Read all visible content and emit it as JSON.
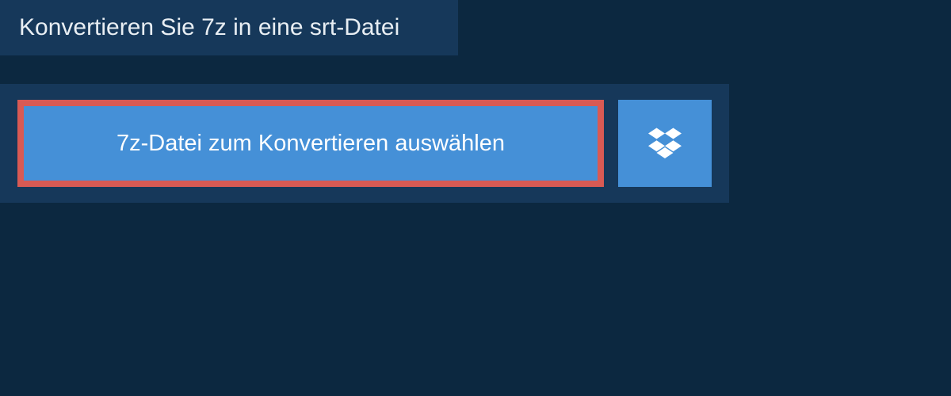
{
  "header": {
    "title": "Konvertieren Sie 7z in eine srt-Datei"
  },
  "converter": {
    "select_file_label": "7z-Datei zum Konvertieren auswählen",
    "dropbox_icon": "dropbox-icon",
    "accent_color": "#4590d7",
    "highlight_border_color": "#d85a54",
    "panel_bg": "#16385a"
  }
}
